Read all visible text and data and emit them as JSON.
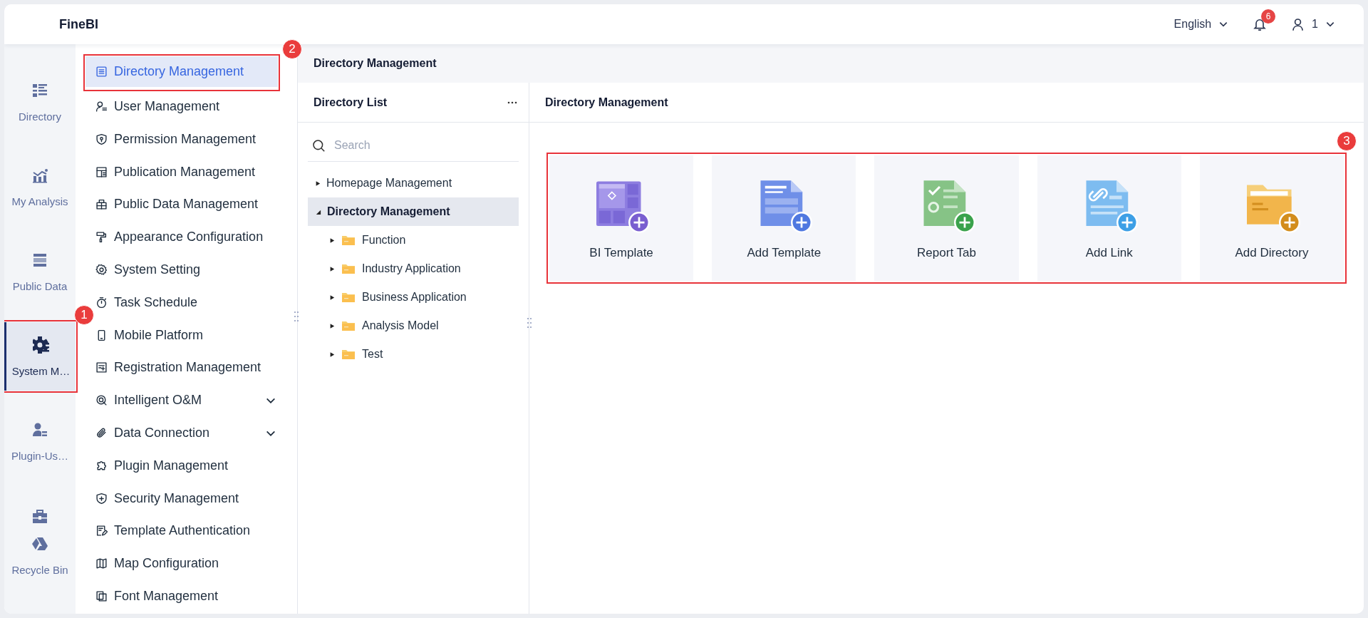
{
  "header": {
    "logo": "FineBI",
    "language": "English",
    "notifications": "6",
    "user": "1"
  },
  "rail": [
    {
      "label": "Directory",
      "selected": false
    },
    {
      "label": "My Analysis",
      "selected": false
    },
    {
      "label": "Public Data",
      "selected": false
    },
    {
      "label": "System M…",
      "selected": true,
      "callout": "1"
    },
    {
      "label": "Plugin-Us…",
      "selected": false
    },
    {
      "selected": false
    },
    {
      "label": "Recycle Bin",
      "selected": false
    }
  ],
  "menu": [
    {
      "label": "Directory Management",
      "kind": "link",
      "selected": true,
      "callout": "2"
    },
    {
      "label": "User Management",
      "kind": "link",
      "selected": false
    },
    {
      "label": "Permission Management",
      "kind": "link",
      "selected": false
    },
    {
      "label": "Publication Management",
      "kind": "link",
      "selected": false
    },
    {
      "label": "Public Data Management",
      "kind": "link",
      "selected": false
    },
    {
      "label": "Appearance Configuration",
      "kind": "link",
      "selected": false
    },
    {
      "label": "System Setting",
      "kind": "link",
      "selected": false
    },
    {
      "label": "Task Schedule",
      "kind": "link",
      "selected": false
    },
    {
      "label": "Mobile Platform",
      "kind": "link",
      "selected": false
    },
    {
      "label": "Registration Management",
      "kind": "link",
      "selected": false
    },
    {
      "label": "Intelligent O&M",
      "kind": "group",
      "selected": false
    },
    {
      "label": "Data Connection",
      "kind": "group",
      "selected": false
    },
    {
      "label": "Plugin Management",
      "kind": "link",
      "selected": false
    },
    {
      "label": "Security Management",
      "kind": "link",
      "selected": false
    },
    {
      "label": "Template Authentication",
      "kind": "link",
      "selected": false
    },
    {
      "label": "Map Configuration",
      "kind": "link",
      "selected": false
    },
    {
      "label": "Font Management",
      "kind": "link",
      "selected": false
    }
  ],
  "breadcrumb": "Directory Management",
  "directory_list": {
    "title": "Directory List",
    "search": {
      "placeholder": "Search"
    },
    "tree": [
      {
        "label": "Homepage Management",
        "expanded": false,
        "selected": false
      },
      {
        "label": "Directory Management",
        "expanded": true,
        "selected": true,
        "children": [
          {
            "label": "Function",
            "expanded": false,
            "selected": false
          },
          {
            "label": "Industry Application",
            "expanded": false,
            "selected": false
          },
          {
            "label": "Business Application",
            "expanded": false,
            "selected": false
          },
          {
            "label": "Analysis Model",
            "expanded": false,
            "selected": false
          },
          {
            "label": "Test",
            "expanded": false,
            "selected": false
          }
        ]
      }
    ]
  },
  "content": {
    "title": "Directory Management",
    "callout": "3",
    "cards": [
      {
        "label": "BI Template"
      },
      {
        "label": "Add Template"
      },
      {
        "label": "Report Tab"
      },
      {
        "label": "Add Link"
      },
      {
        "label": "Add Directory"
      }
    ]
  }
}
